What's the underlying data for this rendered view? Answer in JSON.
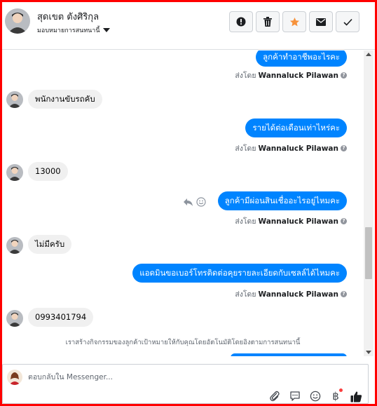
{
  "header": {
    "contact_name": "สุดเขต ตังศิริกุล",
    "assign_label": "มอบหมายการสนทนานี้",
    "buttons": [
      {
        "name": "mark-spam",
        "icon": "exclamation-icon"
      },
      {
        "name": "delete",
        "icon": "trash-icon"
      },
      {
        "name": "star",
        "icon": "star-icon",
        "color": "#f7923b"
      },
      {
        "name": "mark-unread",
        "icon": "envelope-icon"
      },
      {
        "name": "mark-done",
        "icon": "checkmark-icon"
      }
    ]
  },
  "messages": [
    {
      "direction": "out",
      "text": "ลูกค้าทำอาชีพอะไรคะ",
      "sent_by_label": "ส่งโดย",
      "sender": "Wannaluck Pilawan"
    },
    {
      "direction": "in",
      "text": "พนักงานขับรถคับ"
    },
    {
      "direction": "out",
      "text": "รายได้ต่อเดือนเท่าไหร่คะ",
      "sent_by_label": "ส่งโดย",
      "sender": "Wannaluck Pilawan"
    },
    {
      "direction": "in",
      "text": "13000"
    },
    {
      "direction": "out",
      "text": "ลูกค้ามีผ่อนสินเชื่ออะไรอยู่ไหมคะ",
      "sent_by_label": "ส่งโดย",
      "sender": "Wannaluck Pilawan"
    },
    {
      "direction": "in",
      "text": "ไม่มีครับ"
    },
    {
      "direction": "out",
      "text": "แอดมินขอเบอร์โทรติดต่อคุยรายละเอียดกับเซลล์ได้ไหมคะ",
      "sent_by_label": "ส่งโดย",
      "sender": "Wannaluck Pilawan"
    },
    {
      "direction": "in",
      "text": "0993401794"
    }
  ],
  "system_note": "เราสร้างกิจกรรมของลูกค้าเป้าหมายให้กับคุณโดยอัตโนมัติโดยอิงตามการสนทนานี้",
  "composer": {
    "placeholder": "ตอบกลับใน Messenger...",
    "tools": [
      "paperclip-icon",
      "saved-reply-icon",
      "emoji-icon",
      "baht-icon",
      "thumbs-up-icon"
    ]
  },
  "colors": {
    "outgoing_bubble": "#0084ff",
    "incoming_bubble": "#f0f0f0",
    "frame": "#ff0000"
  }
}
